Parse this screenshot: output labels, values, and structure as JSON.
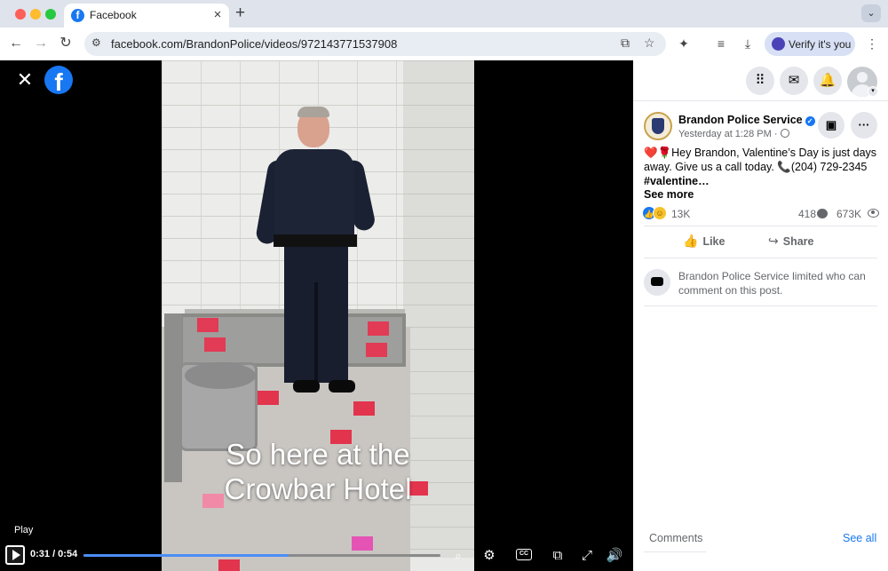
{
  "browser": {
    "tab_title": "Facebook",
    "tab_favicon_letter": "f",
    "url": "facebook.com/BrandonPolice/videos/972143771537908",
    "verify_label": "Verify it's you",
    "colors": {
      "chrome": "#dee3ec",
      "accent": "#4a43b8"
    }
  },
  "video": {
    "caption_line1": "So here at the",
    "caption_line2": "Crowbar Hotel",
    "play_label": "Play",
    "time_display": "0:31 / 0:54",
    "progress_fraction": 0.574,
    "progress_color": "#4b8df6"
  },
  "panel": {
    "page_name": "Brandon Police Service",
    "post_time": "Yesterday at 1:28 PM ·",
    "post_text": "❤️🌹Hey Brandon, Valentine’s Day is just days away. Give us a call today. 📞(204) 729-2345",
    "hashtag": "#valentine…",
    "see_more": "See more",
    "reaction_count": "13K",
    "comment_count": "418",
    "view_count": "673K",
    "like_label": "Like",
    "share_label": "Share",
    "limited_notice": "Brandon Police Service limited who can comment on this post.",
    "comments_label": "Comments",
    "see_all_label": "See all",
    "brand_color": "#1877f2"
  }
}
